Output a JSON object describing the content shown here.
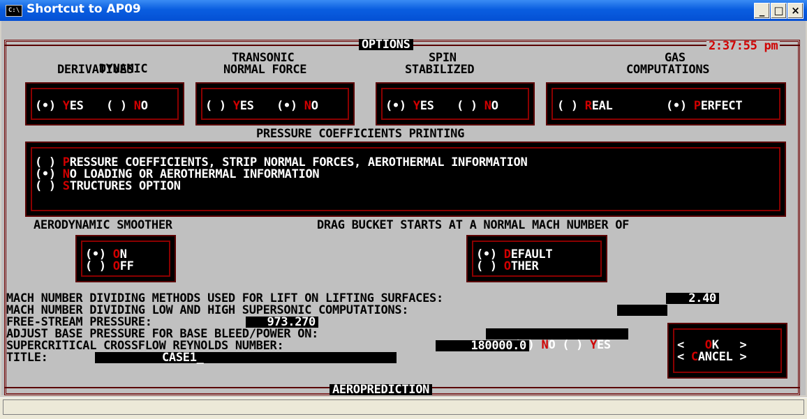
{
  "window": {
    "title": "Shortcut to AP09",
    "icon_label": "C:\\",
    "buttons": {
      "minimize": "_",
      "maximize": "□",
      "close": "×"
    }
  },
  "screen": {
    "header": "OPTIONS",
    "clock": "2:37:55 pm",
    "footer": "AEROPREDICTION",
    "groups": [
      {
        "heading1": "DYNAMIC",
        "heading2": "DERIVATIVES",
        "options": [
          {
            "mark": "(•)",
            "hot": "Y",
            "rest": "ES"
          },
          {
            "mark": "( )",
            "hot": "N",
            "rest": "O"
          }
        ]
      },
      {
        "heading1": "TRANSONIC",
        "heading2": "NORMAL FORCE",
        "options": [
          {
            "mark": "( )",
            "hot": "Y",
            "rest": "ES"
          },
          {
            "mark": "(•)",
            "hot": "N",
            "rest": "O"
          }
        ]
      },
      {
        "heading1": "SPIN",
        "heading2": "STABILIZED",
        "options": [
          {
            "mark": "(•)",
            "hot": "Y",
            "rest": "ES"
          },
          {
            "mark": "( )",
            "hot": "N",
            "rest": "O"
          }
        ]
      },
      {
        "heading1": "GAS",
        "heading2": "COMPUTATIONS",
        "options": [
          {
            "mark": "( )",
            "hot": "R",
            "rest": "EAL"
          },
          {
            "mark": "(•)",
            "hot": "P",
            "rest": "ERFECT"
          }
        ]
      }
    ],
    "pressure": {
      "heading": "PRESSURE COEFFICIENTS PRINTING",
      "options": [
        {
          "mark": "( )",
          "hot": "P",
          "rest": "RESSURE COEFFICIENTS, STRIP NORMAL FORCES, AEROTHERMAL INFORMATION"
        },
        {
          "mark": "(•)",
          "hot": "N",
          "rest": "O LOADING OR AEROTHERMAL INFORMATION"
        },
        {
          "mark": "( )",
          "hot": "S",
          "rest": "TRUCTURES OPTION"
        }
      ]
    },
    "smoother": {
      "heading": "AERODYNAMIC SMOOTHER",
      "options": [
        {
          "mark": "(•)",
          "hot": "O",
          "rest": "N"
        },
        {
          "mark": "( )",
          "hot": "O",
          "rest": "FF"
        }
      ]
    },
    "drag": {
      "heading": "DRAG BUCKET STARTS AT A NORMAL MACH NUMBER OF",
      "options": [
        {
          "mark": "(•)",
          "hot": "D",
          "rest": "EFAULT"
        },
        {
          "mark": "( )",
          "hot": "O",
          "rest": "THER"
        }
      ]
    },
    "fields": {
      "mach_lift_label": "MACH NUMBER DIVIDING METHODS USED FOR LIFT ON LIFTING SURFACES:",
      "mach_lift_value": "2.40",
      "mach_super_label": "MACH NUMBER DIVIDING LOW AND HIGH SUPERSONIC COMPUTATIONS:",
      "mach_super_value": "",
      "pressure_label": "FREE-STREAM PRESSURE:",
      "pressure_value": "973.270",
      "base_label": "ADJUST BASE PRESSURE FOR BASE BLEED/POWER ON:",
      "base_options": [
        {
          "mark": "(•)",
          "hot": "N",
          "rest": "O"
        },
        {
          "mark": "( )",
          "hot": "Y",
          "rest": "ES"
        }
      ],
      "reynolds_label": "SUPERCRITICAL CROSSFLOW REYNOLDS NUMBER:",
      "reynolds_value": "180000.0",
      "title_label": "TITLE:",
      "title_value": "CASE1_"
    },
    "actions": {
      "ok": {
        "left": "<",
        "hot": "O",
        "rest": "K",
        "right": ">"
      },
      "cancel": {
        "left": "<",
        "hot": "C",
        "rest": "ANCEL",
        "right": ">"
      }
    }
  },
  "colors": {
    "accent_red": "#d00000",
    "border_red": "#6e0000",
    "title_blue": "#0a5ee0",
    "console_gray": "#c0c0c0"
  }
}
